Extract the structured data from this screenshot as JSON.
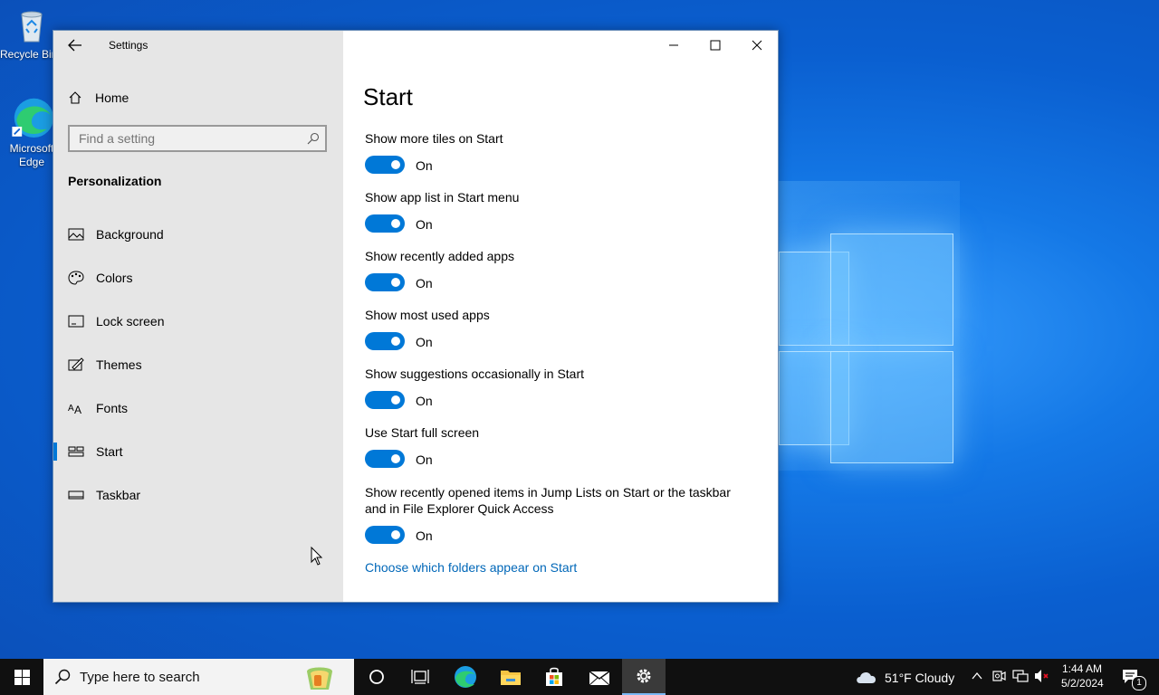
{
  "desktop": {
    "icons": [
      {
        "label": "Recycle Bin",
        "icon": "recycle-bin-icon"
      },
      {
        "label": "Microsoft Edge",
        "icon": "edge-icon"
      }
    ]
  },
  "window": {
    "title": "Settings",
    "controls": [
      "minimize-icon",
      "maximize-icon",
      "close-icon"
    ]
  },
  "sidebar": {
    "home_label": "Home",
    "search_placeholder": "Find a setting",
    "section_title": "Personalization",
    "items": [
      {
        "label": "Background",
        "icon": "background-image-icon",
        "selected": false
      },
      {
        "label": "Colors",
        "icon": "palette-icon",
        "selected": false
      },
      {
        "label": "Lock screen",
        "icon": "lock-screen-icon",
        "selected": false
      },
      {
        "label": "Themes",
        "icon": "themes-brush-icon",
        "selected": false
      },
      {
        "label": "Fonts",
        "icon": "fonts-icon",
        "selected": false
      },
      {
        "label": "Start",
        "icon": "start-tiles-icon",
        "selected": true
      },
      {
        "label": "Taskbar",
        "icon": "taskbar-icon",
        "selected": false
      }
    ]
  },
  "content": {
    "page_title": "Start",
    "settings": [
      {
        "label": "Show more tiles on Start",
        "state": "On"
      },
      {
        "label": "Show app list in Start menu",
        "state": "On"
      },
      {
        "label": "Show recently added apps",
        "state": "On"
      },
      {
        "label": "Show most used apps",
        "state": "On"
      },
      {
        "label": "Show suggestions occasionally in Start",
        "state": "On"
      },
      {
        "label": "Use Start full screen",
        "state": "On"
      },
      {
        "label": "Show recently opened items in Jump Lists on Start or the taskbar and in File Explorer Quick Access",
        "state": "On"
      }
    ],
    "link": "Choose which folders appear on Start"
  },
  "taskbar": {
    "search_placeholder": "Type here to search",
    "weather": "51°F  Cloudy",
    "time": "1:44 AM",
    "date": "5/2/2024",
    "notification_count": "1",
    "accent": "#0078d7"
  }
}
